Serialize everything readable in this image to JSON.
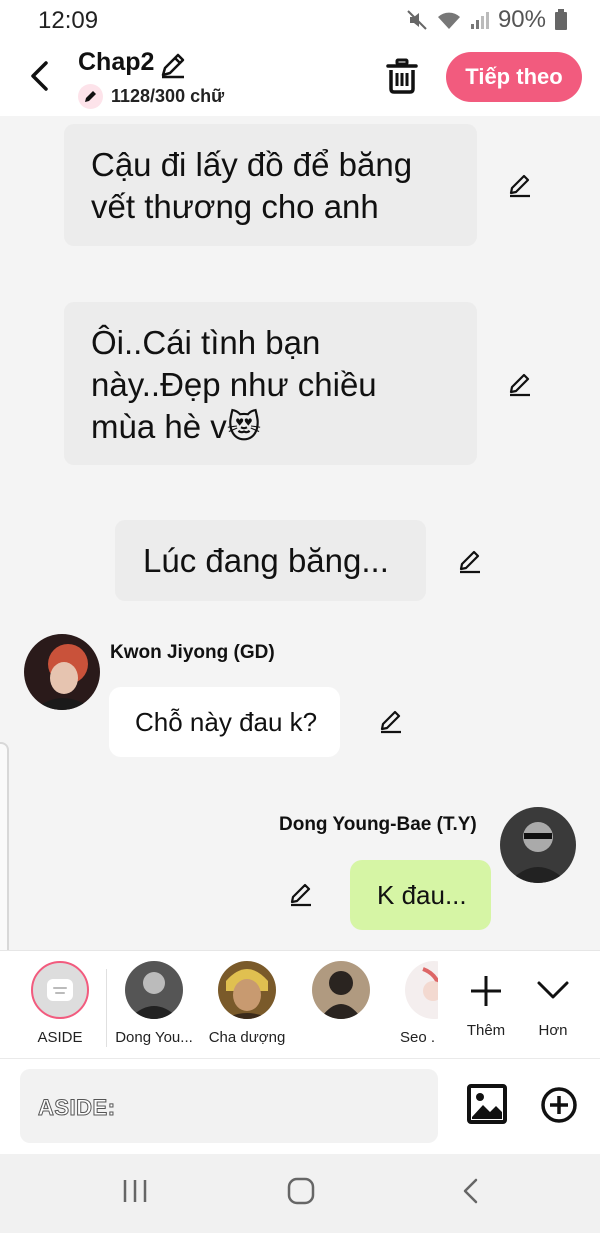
{
  "status": {
    "time": "12:09",
    "battery": "90%"
  },
  "header": {
    "title": "Chap2",
    "word_count": "1128/300 chữ",
    "next_label": "Tiếp theo"
  },
  "messages": [
    {
      "type": "narration",
      "text_line1": "Cậu đi lấy đồ để băng",
      "text_line2": "vết thương cho anh"
    },
    {
      "type": "narration",
      "text_line1": "Ôi..Cái tình bạn",
      "text_line2": "này..Đẹp như chiều",
      "text_line3": "mùa hè v",
      "emoji": "😻"
    },
    {
      "type": "aside",
      "text": "Lúc đang băng..."
    },
    {
      "type": "left",
      "name": "Kwon Jiyong (GD)",
      "text": "Chỗ này đau k?"
    },
    {
      "type": "right",
      "name": "Dong Young-Bae (T.Y)",
      "text": "K đau..."
    }
  ],
  "characters": [
    {
      "label": "ASIDE"
    },
    {
      "label": "Dong You..."
    },
    {
      "label": "Cha dượng"
    },
    {
      "label": ""
    },
    {
      "label": "Seo ."
    }
  ],
  "tools": {
    "add_label": "Thêm",
    "more_label": "Hơn"
  },
  "input": {
    "placeholder": "ASIDE:"
  },
  "colors": {
    "accent": "#f25b7e",
    "green_bubble": "#d6f5a5",
    "gray_bubble": "#ececec"
  }
}
